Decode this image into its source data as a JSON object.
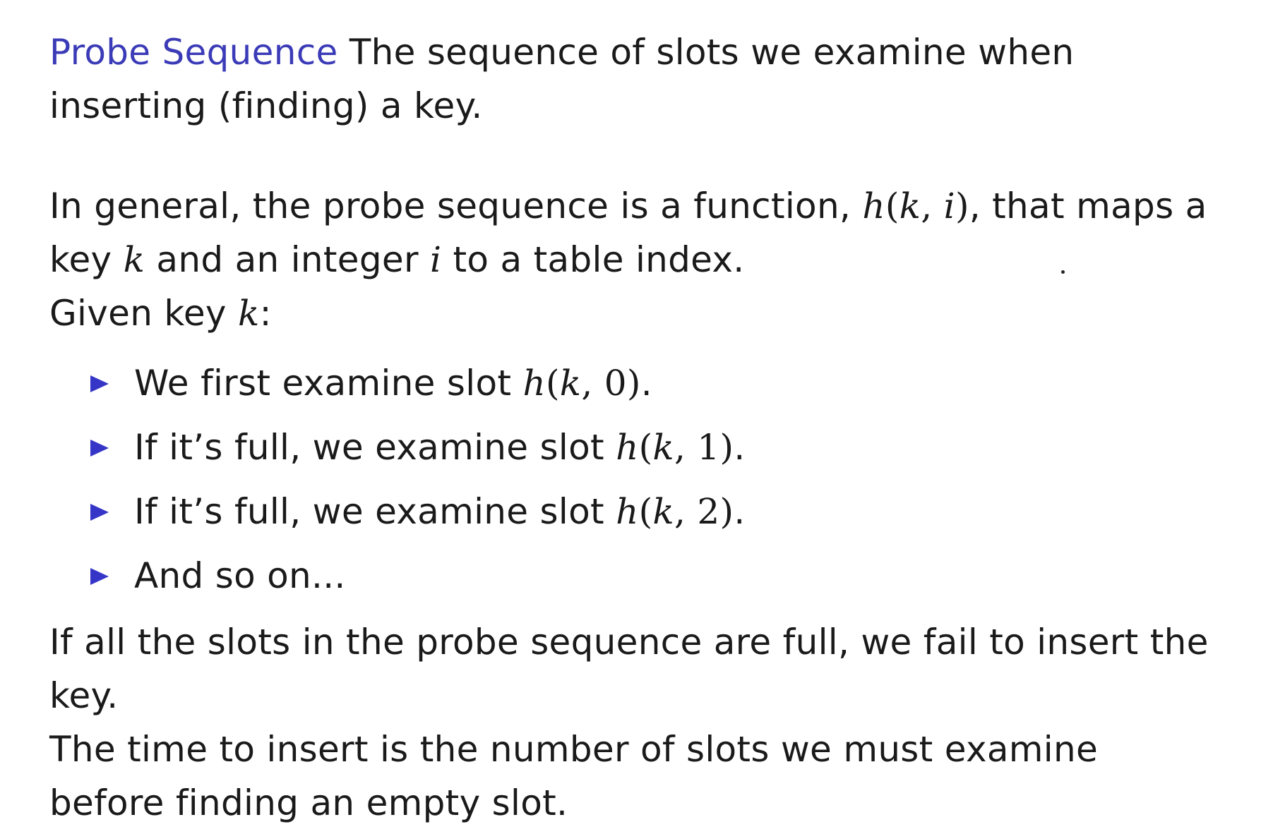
{
  "definition": {
    "term": "Probe Sequence",
    "text": " The sequence of slots we examine when inserting (finding) a key."
  },
  "general": {
    "part1": "In general, the probe sequence is a function, ",
    "func_name": "h",
    "func_open": "(",
    "func_arg_k": "k",
    "func_comma": ", ",
    "func_arg_i": "i",
    "func_close": ")",
    "part2": ", that maps a key ",
    "var_k": "k",
    "part3": " and an integer ",
    "var_i": "i",
    "part4": " to a table index."
  },
  "given": {
    "text": "Given key ",
    "var": "k",
    "colon": ":"
  },
  "bullets": [
    {
      "prefix": "We first examine slot ",
      "h": "h",
      "open": "(",
      "k": "k",
      "comma": ", ",
      "n": "0",
      "close": ")",
      "end": "."
    },
    {
      "prefix": "If it’s full, we examine slot ",
      "h": "h",
      "open": "(",
      "k": "k",
      "comma": ", ",
      "n": "1",
      "close": ")",
      "end": "."
    },
    {
      "prefix": "If it’s full, we examine slot ",
      "h": "h",
      "open": "(",
      "k": "k",
      "comma": ", ",
      "n": "2",
      "close": ")",
      "end": "."
    },
    {
      "text": "And so on..."
    }
  ],
  "fail": {
    "text": "If all the slots in the probe sequence are full, we fail to insert the key."
  },
  "time": {
    "text": "The time to insert is the number of slots we must examine before finding an empty slot."
  },
  "colors": {
    "term": "#3b3bb8",
    "bullet": "#3535c8",
    "text": "#1a1a1a"
  }
}
